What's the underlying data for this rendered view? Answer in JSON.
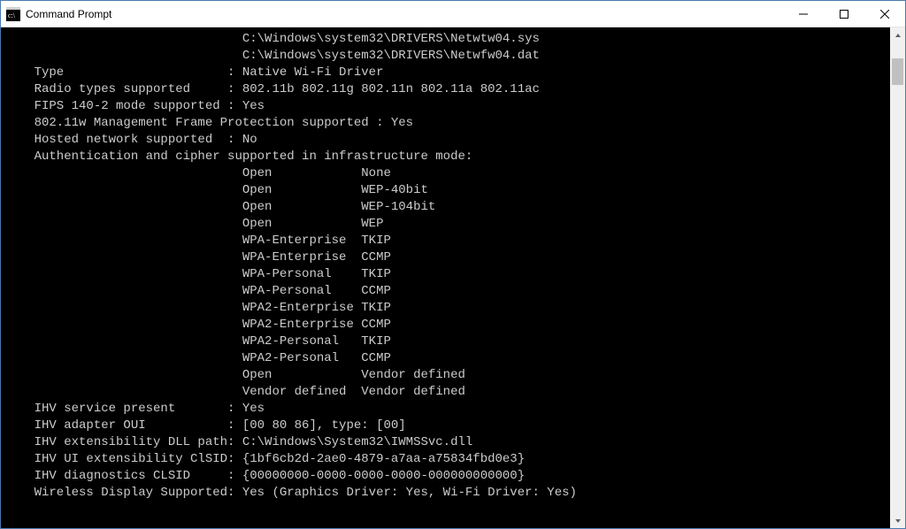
{
  "window": {
    "title": "Command Prompt"
  },
  "terminal": {
    "col_label": 30,
    "col_value": 32,
    "pre_lines": [
      "                                C:\\Windows\\system32\\DRIVERS\\Netwtw04.sys",
      "                                C:\\Windows\\system32\\DRIVERS\\Netwfw04.dat"
    ],
    "props_a": [
      {
        "label": "    Type",
        "value": "Native Wi-Fi Driver"
      },
      {
        "label": "    Radio types supported",
        "value": "802.11b 802.11g 802.11n 802.11a 802.11ac"
      },
      {
        "label": "    FIPS 140-2 mode supported",
        "colon_tight": true,
        "value": "Yes"
      }
    ],
    "inline_a": [
      "    802.11w Management Frame Protection supported : Yes"
    ],
    "props_b": [
      {
        "label": "    Hosted network supported",
        "value": "No"
      }
    ],
    "inline_b": [
      "    Authentication and cipher supported in infrastructure mode:"
    ],
    "auth_cipher_indent": 32,
    "auth_cipher_col1": 16,
    "auth_cipher": [
      {
        "auth": "Open",
        "cipher": "None"
      },
      {
        "auth": "Open",
        "cipher": "WEP-40bit"
      },
      {
        "auth": "Open",
        "cipher": "WEP-104bit"
      },
      {
        "auth": "Open",
        "cipher": "WEP"
      },
      {
        "auth": "WPA-Enterprise",
        "cipher": "TKIP"
      },
      {
        "auth": "WPA-Enterprise",
        "cipher": "CCMP"
      },
      {
        "auth": "WPA-Personal",
        "cipher": "TKIP"
      },
      {
        "auth": "WPA-Personal",
        "cipher": "CCMP"
      },
      {
        "auth": "WPA2-Enterprise",
        "cipher": "TKIP"
      },
      {
        "auth": "WPA2-Enterprise",
        "cipher": "CCMP"
      },
      {
        "auth": "WPA2-Personal",
        "cipher": "TKIP"
      },
      {
        "auth": "WPA2-Personal",
        "cipher": "CCMP"
      },
      {
        "auth": "Open",
        "cipher": "Vendor defined"
      },
      {
        "auth": "Vendor defined",
        "cipher": "Vendor defined"
      }
    ],
    "props_c": [
      {
        "label": "    IHV service present",
        "value": "Yes"
      },
      {
        "label": "    IHV adapter OUI",
        "value": "[00 80 86], type: [00]"
      },
      {
        "label": "    IHV extensibility DLL path",
        "colon_tight": true,
        "value": "C:\\Windows\\System32\\IWMSSvc.dll"
      },
      {
        "label": "    IHV UI extensibility ClSID",
        "colon_tight": true,
        "value": "{1bf6cb2d-2ae0-4879-a7aa-a75834fbd0e3}"
      },
      {
        "label": "    IHV diagnostics CLSID",
        "value": "{00000000-0000-0000-0000-000000000000}"
      },
      {
        "label": "    Wireless Display Supported",
        "colon_tight": true,
        "value": "Yes (Graphics Driver: Yes, Wi-Fi Driver: Yes)"
      }
    ]
  }
}
